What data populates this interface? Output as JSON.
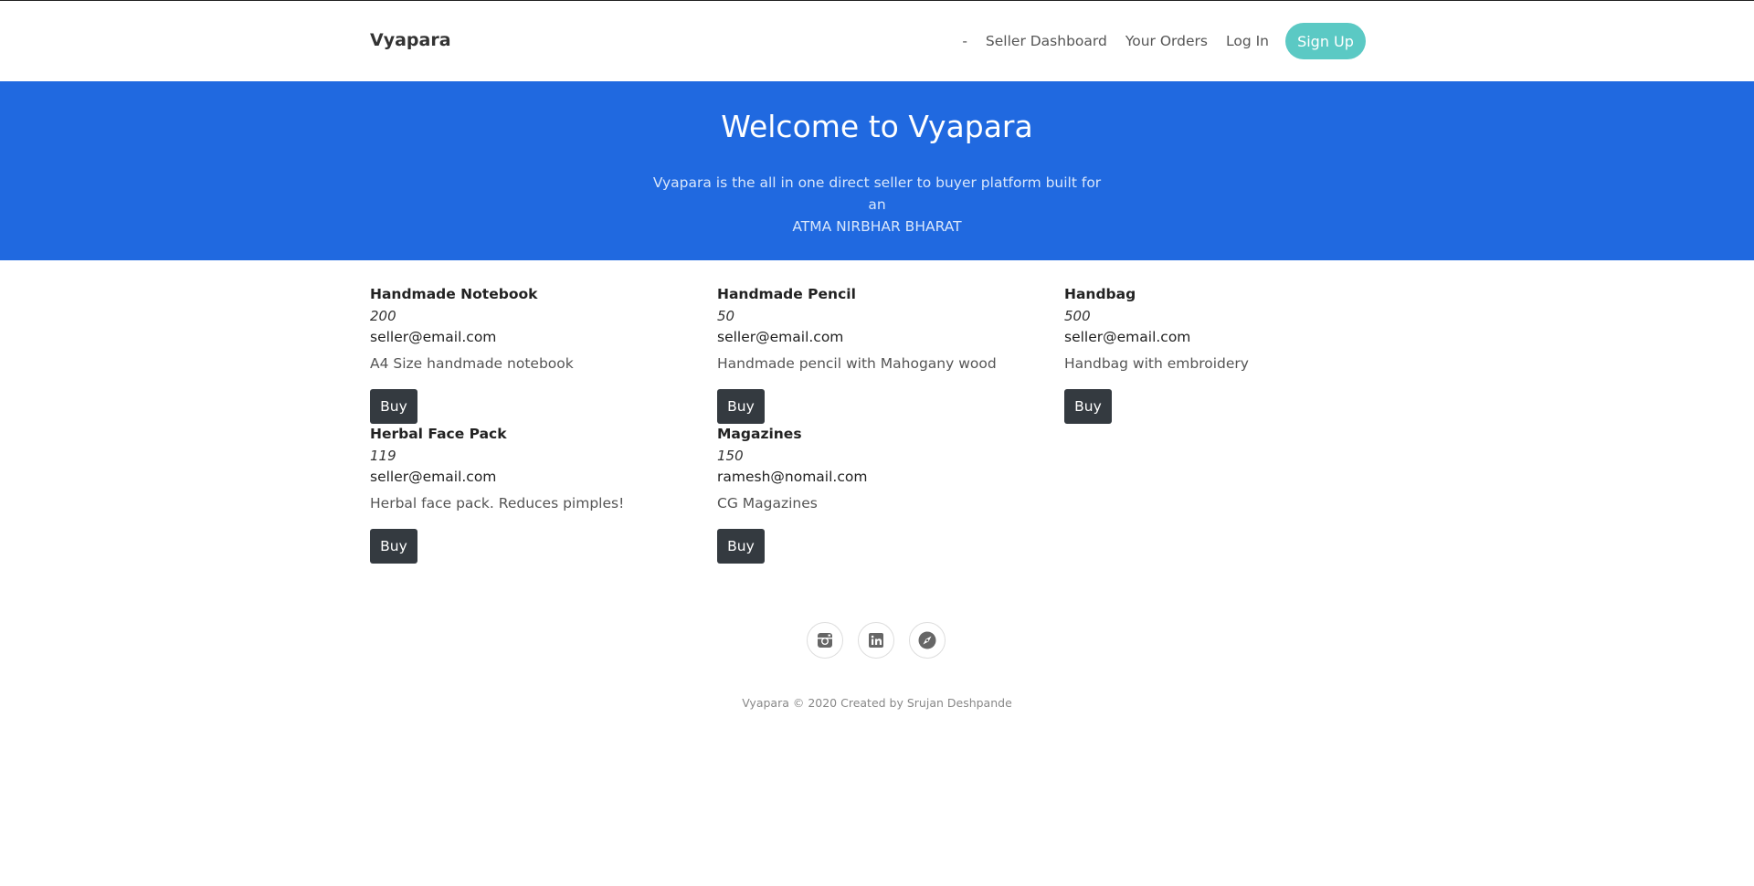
{
  "nav": {
    "brand": "Vyapara",
    "dash": "-",
    "seller_dashboard": "Seller Dashboard",
    "your_orders": "Your Orders",
    "log_in": "Log In",
    "sign_up": "Sign Up"
  },
  "hero": {
    "title": "Welcome to Vyapara",
    "line1": "Vyapara is the all in one direct seller to buyer platform built for an",
    "line2": "ATMA NIRBHAR BHARAT"
  },
  "products": [
    {
      "name": "Handmade Notebook",
      "price": "200",
      "seller": "seller@email.com",
      "description": "A4 Size handmade notebook",
      "button": "Buy"
    },
    {
      "name": "Handmade Pencil",
      "price": "50",
      "seller": "seller@email.com",
      "description": "Handmade pencil with Mahogany wood",
      "button": "Buy"
    },
    {
      "name": "Handbag",
      "price": "500",
      "seller": "seller@email.com",
      "description": "Handbag with embroidery",
      "button": "Buy"
    },
    {
      "name": "Herbal Face Pack",
      "price": "119",
      "seller": "seller@email.com",
      "description": "Herbal face pack. Reduces pimples!",
      "button": "Buy"
    },
    {
      "name": "Magazines",
      "price": "150",
      "seller": "ramesh@nomail.com",
      "description": "CG Magazines",
      "button": "Buy"
    }
  ],
  "footer": {
    "icons": [
      "instagram-icon",
      "linkedin-icon",
      "compass-icon"
    ],
    "copyright": "Vyapara © 2020 Created by Srujan Deshpande"
  },
  "colors": {
    "hero_bg": "#2069e0",
    "signup_bg": "#5bc9c4",
    "buy_bg": "#343a40"
  }
}
